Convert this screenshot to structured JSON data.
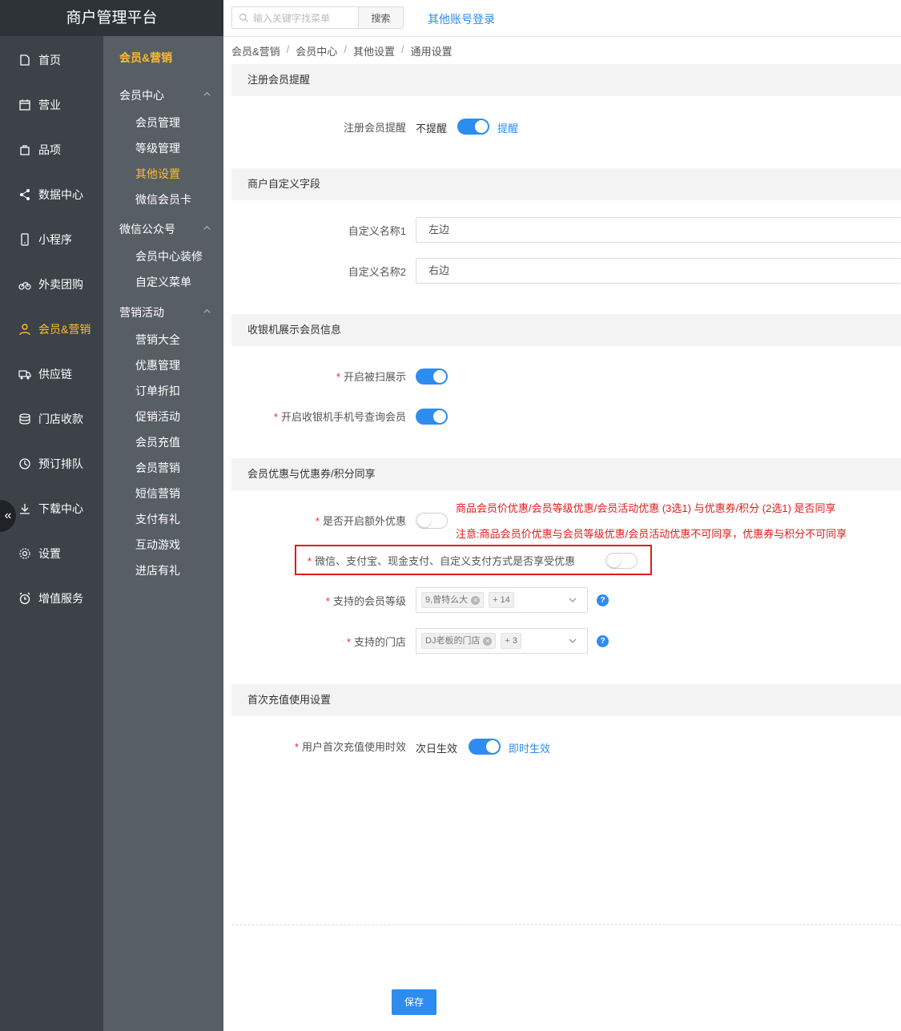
{
  "app": {
    "title": "商户管理平台"
  },
  "nav1": {
    "items": [
      {
        "label": "首页",
        "icon": "home-icon"
      },
      {
        "label": "营业",
        "icon": "calendar-icon"
      },
      {
        "label": "品项",
        "icon": "bag-icon"
      },
      {
        "label": "数据中心",
        "icon": "share-icon"
      },
      {
        "label": "小程序",
        "icon": "phone-icon"
      },
      {
        "label": "外卖团购",
        "icon": "bike-icon"
      },
      {
        "label": "会员&营销",
        "icon": "user-icon"
      },
      {
        "label": "供应链",
        "icon": "truck-icon"
      },
      {
        "label": "门店收款",
        "icon": "database-icon"
      },
      {
        "label": "预订排队",
        "icon": "clock-icon"
      },
      {
        "label": "下载中心",
        "icon": "download-icon"
      },
      {
        "label": "设置",
        "icon": "gear-icon"
      },
      {
        "label": "增值服务",
        "icon": "alarm-icon"
      }
    ],
    "collapse": "«"
  },
  "nav2": {
    "title": "会员&营销",
    "groups": [
      {
        "label": "会员中心",
        "items": [
          "会员管理",
          "等级管理",
          "其他设置",
          "微信会员卡"
        ]
      },
      {
        "label": "微信公众号",
        "items": [
          "会员中心装修",
          "自定义菜单"
        ]
      },
      {
        "label": "营销活动",
        "items": [
          "营销大全",
          "优惠管理",
          "订单折扣",
          "促销活动",
          "会员充值",
          "会员营销",
          "短信营销",
          "支付有礼",
          "互动游戏",
          "进店有礼"
        ]
      }
    ]
  },
  "topbar": {
    "search_placeholder": "输入关键字找菜单",
    "search_button": "搜索",
    "other_login": "其他账号登录"
  },
  "breadcrumb": [
    "会员&营销",
    "会员中心",
    "其他设置",
    "通用设置"
  ],
  "sections": {
    "register": {
      "title": "注册会员提醒",
      "label": "注册会员提醒",
      "off_text": "不提醒",
      "on_text": "提醒",
      "enabled": true
    },
    "custom_fields": {
      "title": "商户自定义字段",
      "field1_label": "自定义名称1",
      "field1_value": "左边",
      "field2_label": "自定义名称2",
      "field2_value": "右边"
    },
    "cashier": {
      "title": "收银机展示会员信息",
      "scan_label": "开启被扫展示",
      "scan_enabled": true,
      "phone_label": "开启收银机手机号查询会员",
      "phone_enabled": true
    },
    "share": {
      "title": "会员优惠与优惠券/积分同享",
      "extra_label": "是否开启额外优惠",
      "extra_enabled": false,
      "note1": "商品会员价优惠/会员等级优惠/会员活动优惠 (3选1) 与优惠券/积分 (2选1) 是否同享",
      "note2": "注意:商品会员价优惠与会员等级优惠/会员活动优惠不可同享，优惠券与积分不可同享",
      "pay_label": "微信、支付宝、现金支付、自定义支付方式是否享受优惠",
      "pay_enabled": false,
      "levels_label": "支持的会员等级",
      "levels_tag": "9,曾特么大",
      "levels_more": "+ 14",
      "stores_label": "支持的门店",
      "stores_tag": "DJ老板的门店",
      "stores_more": "+ 3",
      "help": "?"
    },
    "recharge": {
      "title": "首次充值使用设置",
      "label": "用户首次充值使用时效",
      "off_text": "次日生效",
      "on_text": "即时生效",
      "enabled": true
    }
  },
  "footer": {
    "save": "保存"
  },
  "colors": {
    "primary": "#2d8cf0",
    "accent": "#ffbd2e",
    "danger": "#e01b1b",
    "nav_dark": "#3c4247",
    "nav_sub": "#575e64"
  }
}
